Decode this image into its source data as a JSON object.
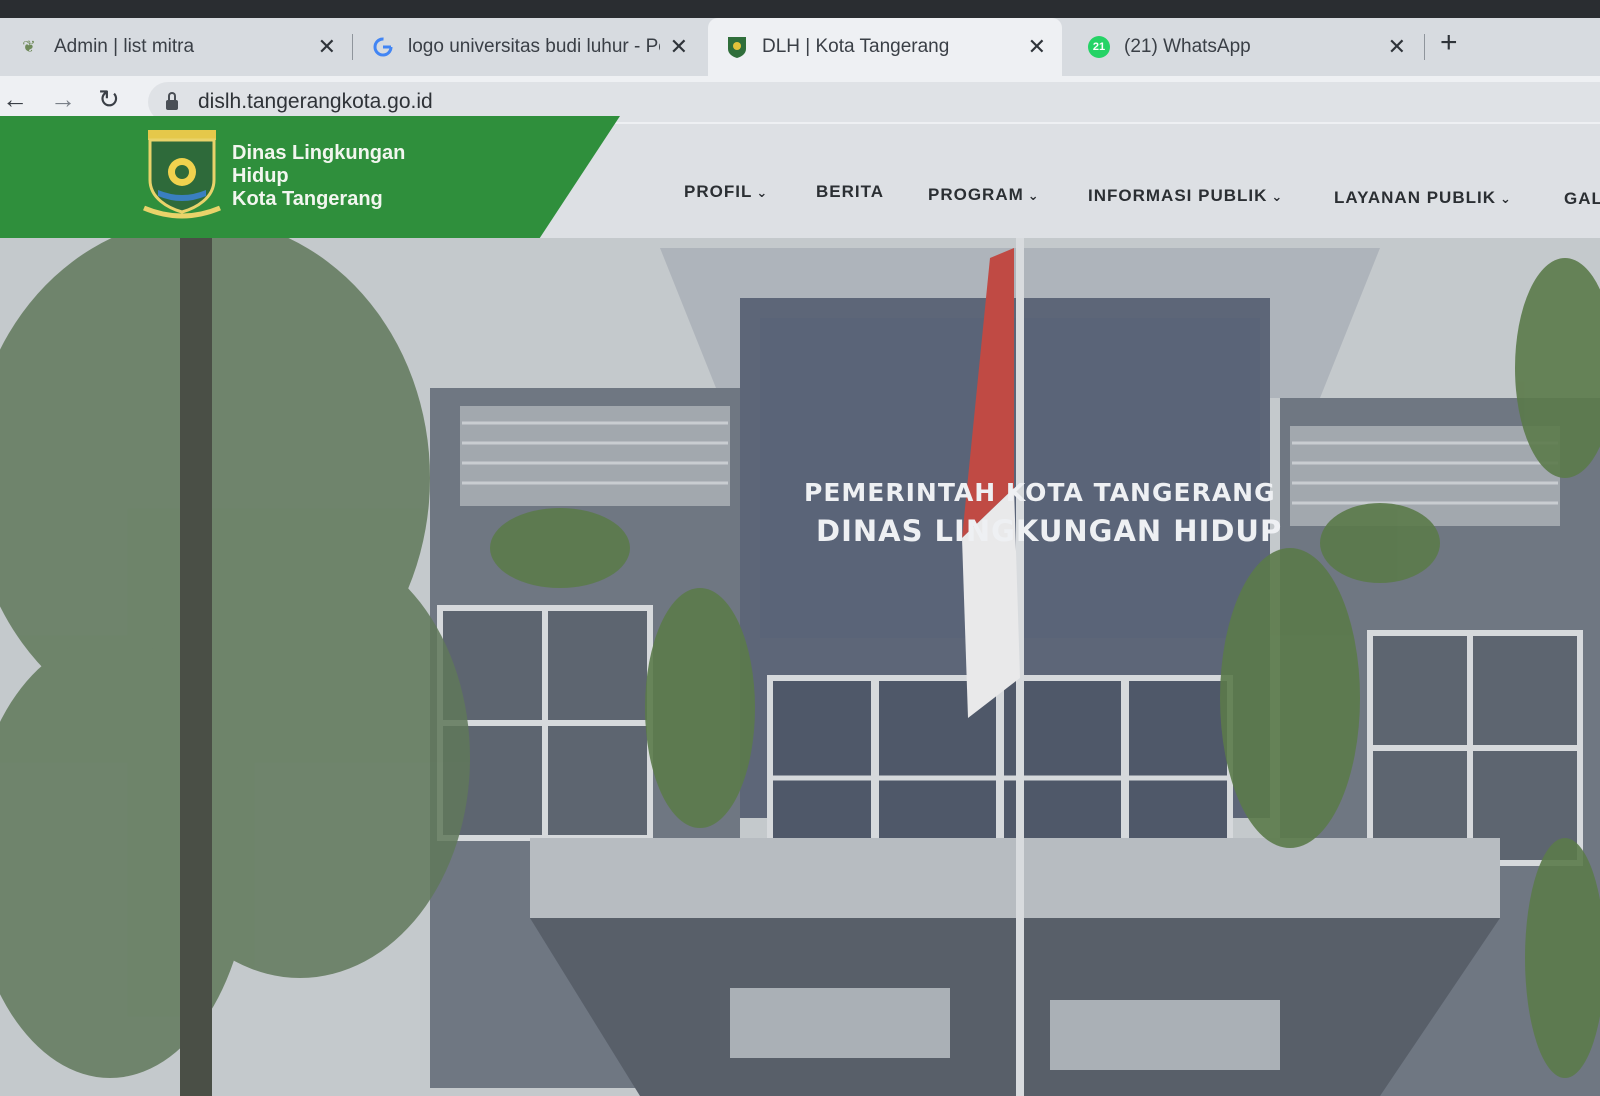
{
  "browser": {
    "tabs": [
      {
        "title": "Admin | list mitra",
        "favicon": "leaf-icon",
        "active": false
      },
      {
        "title": "logo universitas budi luhur - Pen",
        "favicon": "google-icon",
        "active": false
      },
      {
        "title": "DLH | Kota Tangerang",
        "favicon": "crest-icon",
        "active": true
      },
      {
        "title": "(21) WhatsApp",
        "favicon": "whatsapp-icon",
        "active": false
      }
    ],
    "whatsapp_badge": "21",
    "url": "dislh.tangerangkota.go.id"
  },
  "site": {
    "brand_line1": "Dinas Lingkungan",
    "brand_line2": "Hidup",
    "brand_line3": "Kota Tangerang",
    "nav": [
      {
        "label": "PROFIL",
        "dropdown": true
      },
      {
        "label": "BERITA",
        "dropdown": false
      },
      {
        "label": "PROGRAM",
        "dropdown": true
      },
      {
        "label": "INFORMASI PUBLIK",
        "dropdown": true
      },
      {
        "label": "LAYANAN PUBLIK",
        "dropdown": true
      },
      {
        "label": "GAL",
        "dropdown": false
      }
    ],
    "hero_sign_line1": "PEMERINTAH KOTA TANGERANG",
    "hero_sign_line2": "DINAS LINGKUNGAN HIDUP"
  },
  "colors": {
    "brand_green": "#2f8f3c",
    "header_bg": "#dde0e4",
    "whatsapp_green": "#25d366"
  }
}
